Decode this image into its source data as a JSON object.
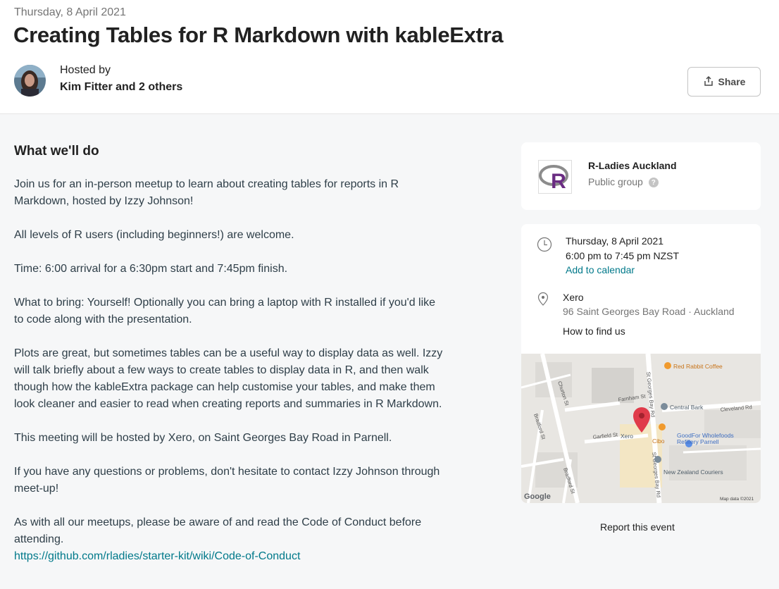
{
  "header": {
    "date": "Thursday, 8 April 2021",
    "title": "Creating Tables for R Markdown with kableExtra",
    "hosted_by_label": "Hosted by",
    "hosts": "Kim Fitter and 2 others",
    "share_label": "Share"
  },
  "details": {
    "heading": "What we'll do",
    "paragraphs": [
      "Join us for an in-person meetup to learn about creating tables for reports in R Markdown, hosted by Izzy Johnson!",
      "All levels of R users (including beginners!) are welcome.",
      "Time: 6:00 arrival for a 6:30pm start and 7:45pm finish.",
      "What to bring: Yourself! Optionally you can bring a laptop with R installed if you'd like to code along with the presentation.",
      "Plots are great, but sometimes tables can be a useful way to display data as well. Izzy will talk briefly about a few ways to create tables to display data in R, and then walk though how the kableExtra package can help customise your tables, and make them look cleaner and easier to read when creating reports and summaries in R Markdown.",
      "This meeting will be hosted by Xero, on Saint Georges Bay Road in Parnell.",
      "If you have any questions or problems, don't hesitate to contact Izzy Johnson through meet-up!",
      "As with all our meetups, please be aware of and read the Code of Conduct before attending."
    ],
    "coc_link": "https://github.com/rladies/starter-kit/wiki/Code-of-Conduct"
  },
  "group": {
    "name": "R-Ladies Auckland",
    "type": "Public group",
    "help_glyph": "?"
  },
  "event_info": {
    "date": "Thursday, 8 April 2021",
    "time": "6:00 pm to 7:45 pm NZST",
    "add_to_calendar": "Add to calendar",
    "venue": "Xero",
    "address": "96 Saint Georges Bay Road · Auckland",
    "how_to_find": "How to find us"
  },
  "map": {
    "streets": [
      "Churton St",
      "Bradford St",
      "Farnham St",
      "St Georges Bay Rd",
      "Garfield St",
      "Cleveland Rd",
      "Bradford St",
      "St Georges Bay Rd"
    ],
    "places": [
      "Red Rabbit Coffee",
      "Central Bark",
      "Xero",
      "Cibo",
      "GoodFor Wholefoods",
      "Refillery Parnell",
      "New Zealand Couriers"
    ],
    "brand": "Google",
    "attribution": "Map data ©2021"
  },
  "footer": {
    "report": "Report this event"
  },
  "colors": {
    "link": "#00798a",
    "map_pin": "#e03b4a",
    "page_bg": "#f6f7f8"
  }
}
